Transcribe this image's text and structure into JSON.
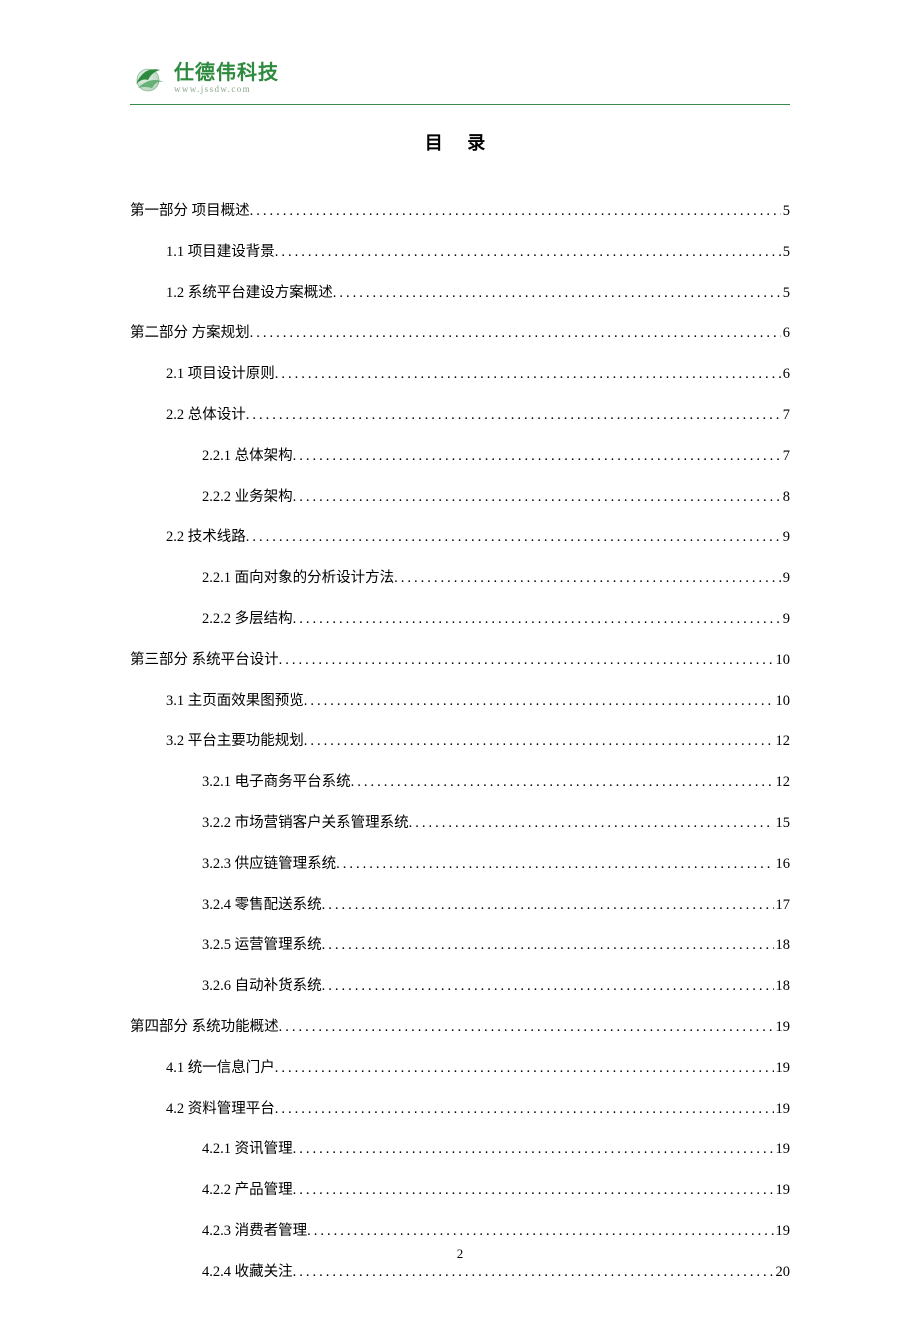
{
  "logo": {
    "cn": "仕德伟科技",
    "en": "www.jssdw.com"
  },
  "title": "目 录",
  "toc": [
    {
      "level": 1,
      "label": "第一部分  项目概述",
      "page": "5"
    },
    {
      "level": 2,
      "label": "1.1 项目建设背景",
      "page": "5"
    },
    {
      "level": 2,
      "label": "1.2 系统平台建设方案概述",
      "page": "5"
    },
    {
      "level": 1,
      "label": "第二部分  方案规划",
      "page": "6"
    },
    {
      "level": 2,
      "label": "2.1 项目设计原则",
      "page": "6"
    },
    {
      "level": 2,
      "label": "2.2 总体设计",
      "page": "7"
    },
    {
      "level": 3,
      "label": "2.2.1 总体架构",
      "page": "7"
    },
    {
      "level": 3,
      "label": "2.2.2 业务架构",
      "page": "8"
    },
    {
      "level": 2,
      "label": "2.2 技术线路",
      "page": "9"
    },
    {
      "level": 3,
      "label": "2.2.1 面向对象的分析设计方法",
      "page": "9"
    },
    {
      "level": 3,
      "label": "2.2.2 多层结构",
      "page": "9"
    },
    {
      "level": 1,
      "label": "第三部分  系统平台设计",
      "page": "10"
    },
    {
      "level": 2,
      "label": "3.1 主页面效果图预览",
      "page": "10"
    },
    {
      "level": 2,
      "label": "3.2 平台主要功能规划",
      "page": "12"
    },
    {
      "level": 3,
      "label": "3.2.1 电子商务平台系统",
      "page": "12"
    },
    {
      "level": 3,
      "label": "3.2.2 市场营销客户关系管理系统",
      "page": "15"
    },
    {
      "level": 3,
      "label": "3.2.3 供应链管理系统 ",
      "page": "16"
    },
    {
      "level": 3,
      "label": "3.2.4 零售配送系统",
      "page": "17"
    },
    {
      "level": 3,
      "label": "3.2.5 运营管理系统",
      "page": "18"
    },
    {
      "level": 3,
      "label": "3.2.6 自动补货系统",
      "page": "18"
    },
    {
      "level": 1,
      "label": "第四部分  系统功能概述",
      "page": "19"
    },
    {
      "level": 2,
      "label": "4.1 统一信息门户",
      "page": "19"
    },
    {
      "level": 2,
      "label": "4.2 资料管理平台",
      "page": "19"
    },
    {
      "level": 3,
      "label": "4.2.1 资讯管理",
      "page": "19"
    },
    {
      "level": 3,
      "label": "4.2.2 产品管理",
      "page": "19"
    },
    {
      "level": 3,
      "label": "4.2.3 消费者管理",
      "page": "19"
    },
    {
      "level": 3,
      "label": "4.2.4 收藏关注",
      "page": "20"
    }
  ],
  "page_number": "2"
}
